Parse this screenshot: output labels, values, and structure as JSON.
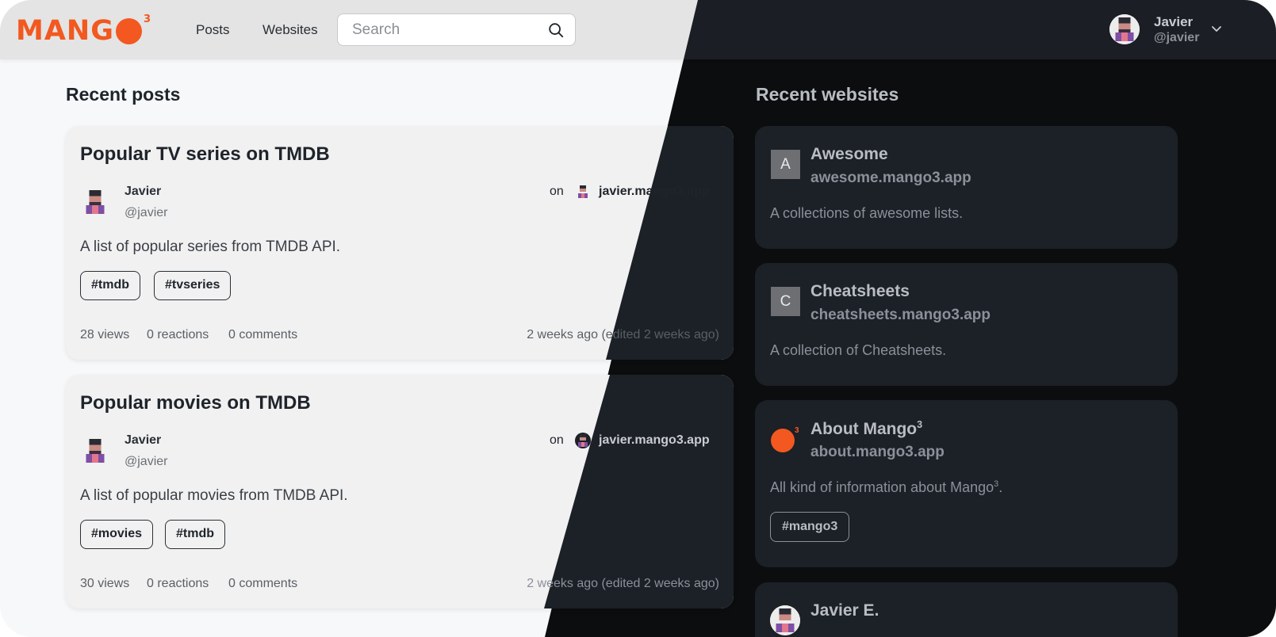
{
  "brand": {
    "logo_text": "MANG",
    "logo_sup": "3",
    "accent": "#f2581f"
  },
  "nav": {
    "posts": "Posts",
    "websites": "Websites"
  },
  "search": {
    "placeholder": "Search"
  },
  "user": {
    "name": "Javier",
    "handle": "@javier"
  },
  "recent_posts": {
    "title": "Recent posts",
    "items": [
      {
        "title": "Popular TV series on TMDB",
        "author": "Javier",
        "handle": "@javier",
        "on": "on",
        "site": "javier.mango3.app",
        "description": "A list of popular series from TMDB API.",
        "tags": [
          "#tmdb",
          "#tvseries"
        ],
        "views": "28 views",
        "reactions": "0 reactions",
        "comments": "0 comments",
        "time": "2 weeks ago (edited 2 weeks ago)"
      },
      {
        "title": "Popular movies on TMDB",
        "author": "Javier",
        "handle": "@javier",
        "on": "on",
        "site": "javier.mango3.app",
        "description": "A list of popular movies from TMDB API.",
        "tags": [
          "#movies",
          "#tmdb"
        ],
        "views": "30 views",
        "reactions": "0 reactions",
        "comments": "0 comments",
        "time": "2 weeks ago (edited 2 weeks ago)"
      }
    ]
  },
  "recent_websites": {
    "title": "Recent websites",
    "items": [
      {
        "icon_letter": "A",
        "name": "Awesome",
        "url": "awesome.mango3.app",
        "description": "A collections of awesome lists."
      },
      {
        "icon_letter": "C",
        "name": "Cheatsheets",
        "url": "cheatsheets.mango3.app",
        "description": "A collection of Cheatsheets."
      },
      {
        "icon": "mango-logo-icon",
        "name": "About Mango",
        "name_sup": "3",
        "url": "about.mango3.app",
        "description": "All kind of information about Mango",
        "description_sup": "3",
        "description_end": ".",
        "tag": "#mango3"
      },
      {
        "name": "Javier E."
      }
    ]
  }
}
